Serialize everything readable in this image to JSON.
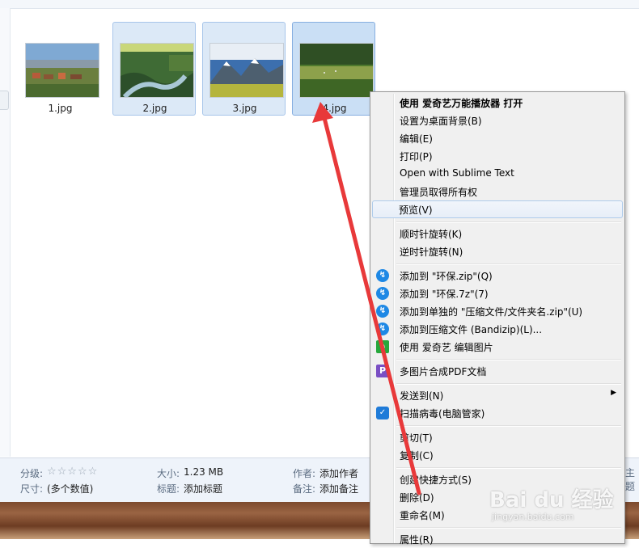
{
  "files": [
    {
      "name": "1.jpg",
      "thumb": "village-landscape",
      "selected": false
    },
    {
      "name": "2.jpg",
      "thumb": "river-forest",
      "selected": true
    },
    {
      "name": "3.jpg",
      "thumb": "snow-mountains",
      "selected": true
    },
    {
      "name": "4.jpg",
      "thumb": "grassland-forest",
      "selected": true,
      "focused": true
    }
  ],
  "details": {
    "rating_label": "分级:",
    "rating_stars": "☆☆☆☆☆",
    "dimensions_label": "尺寸:",
    "dimensions_value": "(多个数值)",
    "size_label": "大小:",
    "size_value": "1.23 MB",
    "title_label": "标题:",
    "title_value": "添加标题",
    "author_label": "作者:",
    "author_value": "添加作者",
    "comments_label": "备注:",
    "comments_value": "添加备注",
    "partial_right": "主题"
  },
  "context_menu": {
    "items": [
      {
        "label": "使用 爱奇艺万能播放器 打开",
        "bold": true
      },
      {
        "label": "设置为桌面背景(B)"
      },
      {
        "label": "编辑(E)"
      },
      {
        "label": "打印(P)"
      },
      {
        "label": "Open with Sublime Text"
      },
      {
        "label": "管理员取得所有权"
      },
      {
        "label": "预览(V)",
        "highlighted": true
      },
      {
        "label": "顺时针旋转(K)"
      },
      {
        "label": "逆时针旋转(N)"
      },
      {
        "label": "添加到 \"环保.zip\"(Q)",
        "icon": "bandizip-icon"
      },
      {
        "label": "添加到 \"环保.7z\"(7)",
        "icon": "bandizip-icon"
      },
      {
        "label": "添加到单独的 \"压缩文件/文件夹名.zip\"(U)",
        "icon": "bandizip-icon"
      },
      {
        "label": "添加到压缩文件 (Bandizip)(L)...",
        "icon": "bandizip-icon"
      },
      {
        "label": "使用 爱奇艺 编辑图片",
        "icon": "iqiyi-edit-icon"
      },
      {
        "label": "多图片合成PDF文档",
        "icon": "pdf-merge-icon"
      },
      {
        "label": "发送到(N)",
        "submenu": true
      },
      {
        "label": "扫描病毒(电脑管家)",
        "icon": "shield-icon"
      },
      {
        "label": "剪切(T)"
      },
      {
        "label": "复制(C)"
      },
      {
        "label": "创建快捷方式(S)"
      },
      {
        "label": "删除(D)"
      },
      {
        "label": "重命名(M)"
      },
      {
        "label": "属性(R)"
      }
    ]
  },
  "watermark": {
    "text": "Bai du 经验",
    "sub": "jingyan.baidu.com"
  },
  "colors": {
    "selection": "#dce9f7",
    "arrow": "#e8393a",
    "menu_bg": "#f0f0f0"
  }
}
